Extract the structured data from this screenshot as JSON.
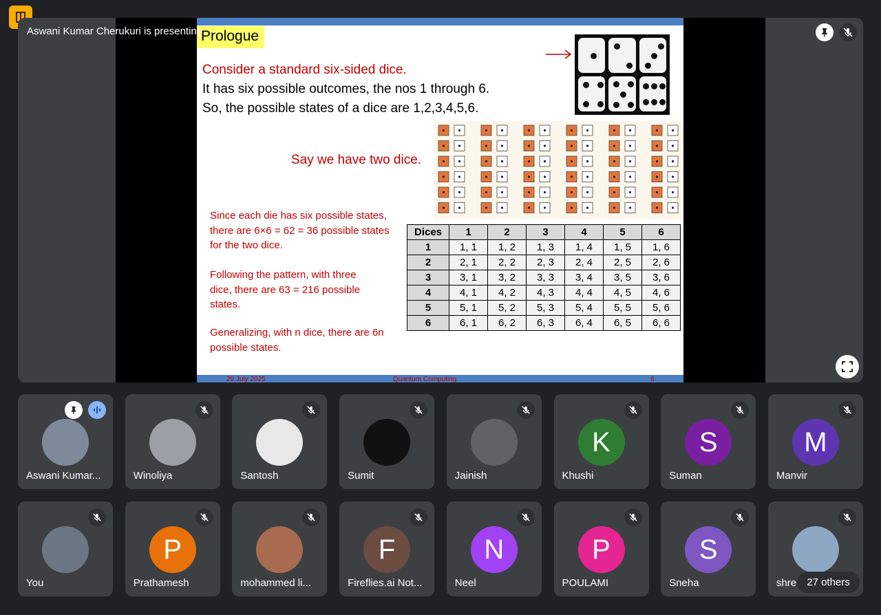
{
  "presenting_label": "Aswani Kumar Cherukuri is presenting",
  "slide": {
    "title": "Prologue",
    "line1": "Consider a standard six-sided dice.",
    "line2": "It has six possible outcomes, the nos 1 through 6.",
    "line3": "So, the possible states of a dice are 1,2,3,4,5,6.",
    "say_two_dice": "Say we have two dice.",
    "note1_a": "Since each die has six possible states,",
    "note1_b": "there are 6×6 = 62 = 36 possible states",
    "note1_c": "for the two dice.",
    "note2_a": "Following the pattern, with three",
    "note2_b": "dice, there are 63 = 216 possible",
    "note2_c": "states.",
    "note3_a": "Generalizing, with n dice, there are 6n",
    "note3_b": "possible states.",
    "footer_date": "29 July 2025",
    "footer_subject": "Quantum Computing",
    "footer_page": "6",
    "table": {
      "corner": "Dices",
      "col_headers": [
        "1",
        "2",
        "3",
        "4",
        "5",
        "6"
      ],
      "rows": [
        {
          "head": "1",
          "cells": [
            "1, 1",
            "1, 2",
            "1, 3",
            "1, 4",
            "1, 5",
            "1, 6"
          ]
        },
        {
          "head": "2",
          "cells": [
            "2, 1",
            "2, 2",
            "2, 3",
            "2, 4",
            "2, 5",
            "2, 6"
          ]
        },
        {
          "head": "3",
          "cells": [
            "3, 1",
            "3, 2",
            "3, 3",
            "3, 4",
            "3, 5",
            "3, 6"
          ]
        },
        {
          "head": "4",
          "cells": [
            "4, 1",
            "4, 2",
            "4, 3",
            "4, 4",
            "4, 5",
            "4, 6"
          ]
        },
        {
          "head": "5",
          "cells": [
            "5, 1",
            "5, 2",
            "5, 3",
            "5, 4",
            "5, 5",
            "5, 6"
          ]
        },
        {
          "head": "6",
          "cells": [
            "6, 1",
            "6, 2",
            "6, 3",
            "6, 4",
            "6, 5",
            "6, 6"
          ]
        }
      ]
    }
  },
  "participants_row1": [
    {
      "name": "Aswani Kumar...",
      "avatar_type": "photo",
      "color": "#7d8a99"
    },
    {
      "name": "Winoliya",
      "avatar_type": "photo",
      "color": "#9aa0a6"
    },
    {
      "name": "Santosh",
      "avatar_type": "photo",
      "color": "#e8e8e8"
    },
    {
      "name": "Sumit",
      "avatar_type": "photo",
      "color": "#111111"
    },
    {
      "name": "Jainish",
      "avatar_type": "photo",
      "color": "#5f6368"
    },
    {
      "name": "Khushi",
      "avatar_type": "letter",
      "letter": "K",
      "color": "#2e7d32"
    },
    {
      "name": "Suman",
      "avatar_type": "letter",
      "letter": "S",
      "color": "#7b1fa2"
    },
    {
      "name": "Manvir",
      "avatar_type": "letter",
      "letter": "M",
      "color": "#5e35b1"
    }
  ],
  "participants_row2": [
    {
      "name": "You",
      "avatar_type": "photo",
      "color": "#6b7785"
    },
    {
      "name": "Prathamesh",
      "avatar_type": "letter",
      "letter": "P",
      "color": "#e8710a"
    },
    {
      "name": "mohammed li...",
      "avatar_type": "photo",
      "color": "#a86b4f"
    },
    {
      "name": "Fireflies.ai Not...",
      "avatar_type": "letter",
      "letter": "F",
      "color": "#6d4c41"
    },
    {
      "name": "Neel",
      "avatar_type": "letter",
      "letter": "N",
      "color": "#a142f4"
    },
    {
      "name": "POULAMI",
      "avatar_type": "letter",
      "letter": "P",
      "color": "#e52592"
    },
    {
      "name": "Sneha",
      "avatar_type": "letter",
      "letter": "S",
      "color": "#7e57c2"
    },
    {
      "name": "shre",
      "avatar_type": "photo",
      "color": "#8ea8c3"
    }
  ],
  "others_label": "27 others",
  "icons": {
    "pin": "pin-icon",
    "mic_off": "mic-off-icon",
    "fullscreen": "fullscreen-icon",
    "speaking": "speaking-icon",
    "unpin": "unpin-icon"
  }
}
